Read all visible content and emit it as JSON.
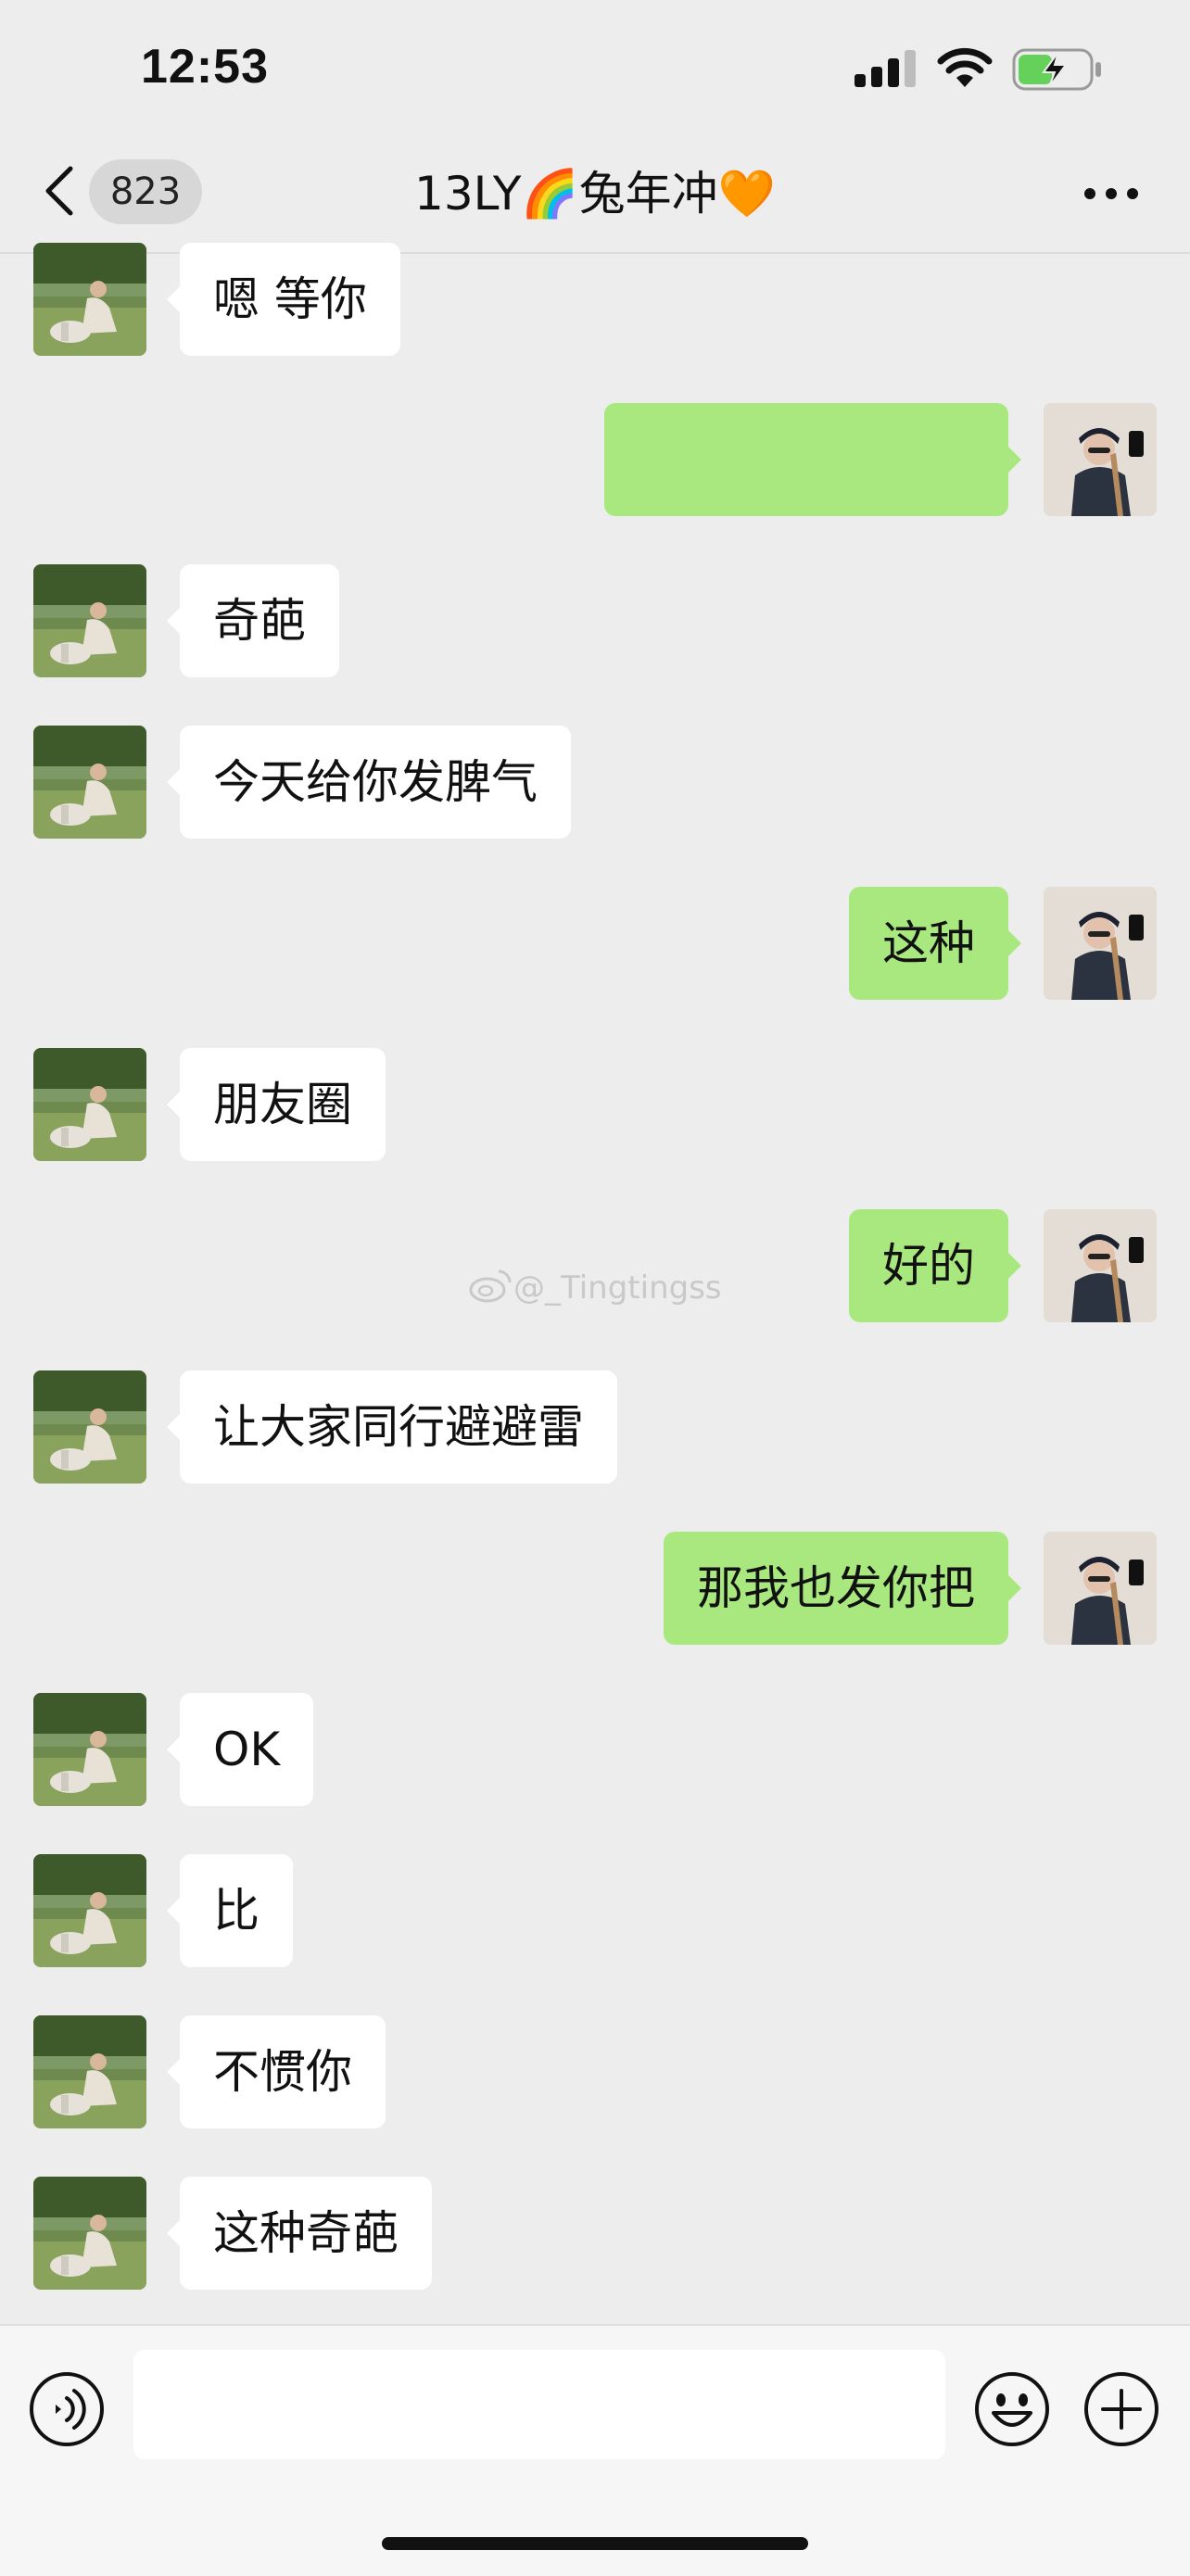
{
  "status_bar": {
    "time": "12:53",
    "signal_icon": "cellular-signal-icon",
    "wifi_icon": "wifi-icon",
    "battery_icon": "battery-charging-icon"
  },
  "nav": {
    "back_icon": "chevron-left-icon",
    "unread_count": "823",
    "title": "13LY🌈兔年冲🧡",
    "more_icon": "more-dots-icon"
  },
  "messages": [
    {
      "side": "in",
      "text": "嗯 等你"
    },
    {
      "side": "out",
      "text": ""
    },
    {
      "side": "in",
      "text": "奇葩"
    },
    {
      "side": "in",
      "text": "今天给你发脾气"
    },
    {
      "side": "out",
      "text": "这种"
    },
    {
      "side": "in",
      "text": "朋友圈"
    },
    {
      "side": "out",
      "text": "好的"
    },
    {
      "side": "in",
      "text": "让大家同行避避雷"
    },
    {
      "side": "out",
      "text": "那我也发你把"
    },
    {
      "side": "in",
      "text": "OK"
    },
    {
      "side": "in",
      "text": "比"
    },
    {
      "side": "in",
      "text": "不惯你"
    },
    {
      "side": "in",
      "text": "这种奇葩"
    }
  ],
  "watermark": "@_Tingtingss",
  "input_bar": {
    "voice_icon": "voice-input-icon",
    "emoji_icon": "emoji-icon",
    "plus_icon": "plus-icon",
    "placeholder": ""
  },
  "colors": {
    "background": "#ededed",
    "incoming_bubble": "#ffffff",
    "outgoing_bubble": "#a9e87f",
    "battery_fill": "#65d15a"
  }
}
